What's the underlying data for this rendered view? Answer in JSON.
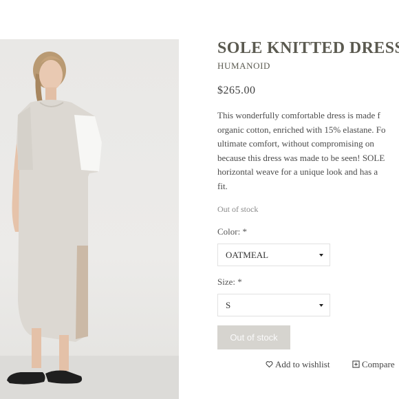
{
  "product": {
    "title": "SOLE KNITTED DRESS",
    "brand": "HUMANOID",
    "price": "$265.00",
    "description_lines": [
      "This wonderfully comfortable dress is made f",
      "organic cotton, enriched with 15% elastane. Fo",
      "ultimate comfort, without compromising on",
      "because this dress was made to be seen! SOLE",
      "horizontal weave for a unique look and has a",
      "fit."
    ],
    "stock_status": "Out of stock"
  },
  "options": {
    "color": {
      "label": "Color: *",
      "value": "OATMEAL"
    },
    "size": {
      "label": "Size: *",
      "value": "S"
    }
  },
  "actions": {
    "buy_label": "Out of stock",
    "wishlist_label": "Add to wishlist",
    "compare_label": "Compare"
  },
  "icons": {
    "wishlist": "heart-icon",
    "compare": "plus-square-icon",
    "dropdown": "caret-down-icon"
  },
  "colors": {
    "title": "#5b5a50",
    "button_disabled": "#d6d4cf",
    "image_background": "#e9e8e6"
  }
}
